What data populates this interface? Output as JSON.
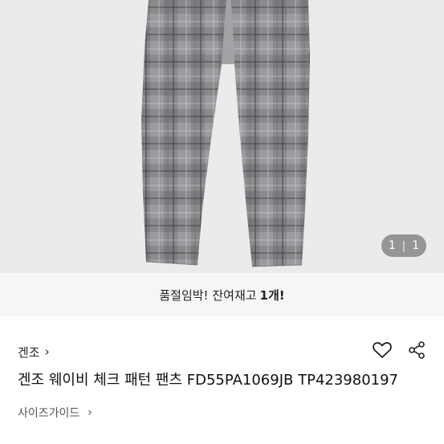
{
  "gallery": {
    "current_page": "1",
    "separator": "|",
    "total_pages": "1",
    "image_alt": "체크 패턴 팬츠"
  },
  "stock_banner": {
    "prefix": "품절임박! 잔여재고",
    "count": "1개!"
  },
  "product": {
    "brand": "겐조",
    "brand_chevron": "›",
    "title": "겐조 웨이비 체크 패턴 팬츠 FD55PA1069JB TP423980197",
    "size_guide_label": "사이즈가이드",
    "size_guide_chevron": "›"
  },
  "icons": {
    "like": "heart-icon",
    "share": "share-icon"
  },
  "colors": {
    "banner_bg": "#f6f6f6",
    "gallery_bg": "#e9e9e9"
  }
}
